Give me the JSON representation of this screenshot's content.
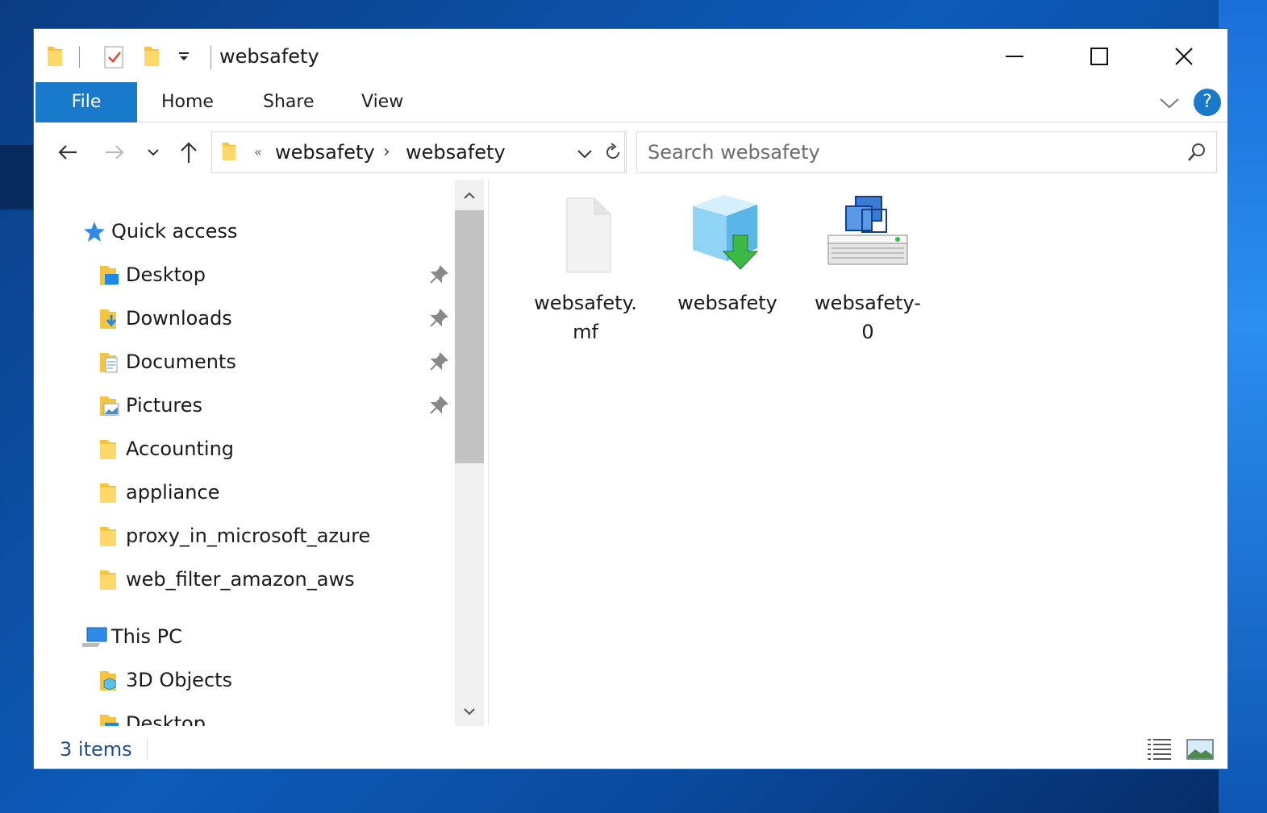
{
  "window": {
    "title": "websafety"
  },
  "ribbon": {
    "tabs": [
      {
        "label": "File"
      },
      {
        "label": "Home"
      },
      {
        "label": "Share"
      },
      {
        "label": "View"
      }
    ],
    "help_label": "?"
  },
  "address": {
    "overflow_glyph": "«",
    "crumbs": [
      "websafety",
      "websafety"
    ],
    "separator": "›"
  },
  "search": {
    "placeholder": "Search websafety"
  },
  "nav": {
    "quick_access": "Quick access",
    "quick_items": [
      {
        "label": "Desktop",
        "icon": "desktop-folder-icon",
        "pinned": true
      },
      {
        "label": "Downloads",
        "icon": "downloads-folder-icon",
        "pinned": true
      },
      {
        "label": "Documents",
        "icon": "documents-folder-icon",
        "pinned": true
      },
      {
        "label": "Pictures",
        "icon": "pictures-folder-icon",
        "pinned": true
      },
      {
        "label": "Accounting",
        "icon": "folder-icon",
        "pinned": false
      },
      {
        "label": "appliance",
        "icon": "folder-icon",
        "pinned": false
      },
      {
        "label": "proxy_in_microsoft_azure",
        "icon": "folder-icon",
        "pinned": false
      },
      {
        "label": "web_filter_amazon_aws",
        "icon": "folder-icon",
        "pinned": false
      }
    ],
    "this_pc": "This PC",
    "pc_items": [
      {
        "label": "3D Objects",
        "icon": "3d-objects-folder-icon"
      },
      {
        "label": "Desktop",
        "icon": "desktop-folder-icon"
      }
    ]
  },
  "files": [
    {
      "line1": "websafety.",
      "line2": "mf",
      "icon": "blank-file-icon"
    },
    {
      "line1": "websafety",
      "line2": "",
      "icon": "ovf-package-icon"
    },
    {
      "line1": "websafety-",
      "line2": "0",
      "icon": "virtual-disk-icon"
    }
  ],
  "status": {
    "count": "3 items"
  },
  "colors": {
    "accent": "#1979ca",
    "folder": "#f5c542",
    "desktop_bg": "#0d5bb8"
  }
}
